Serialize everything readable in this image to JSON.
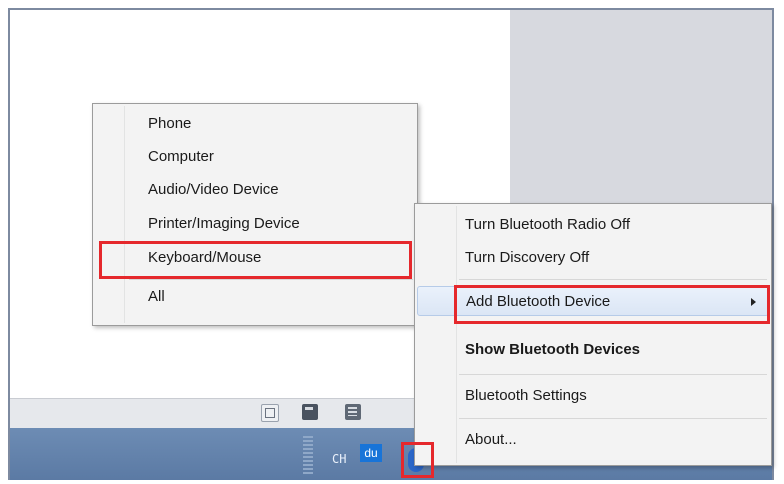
{
  "submenu": {
    "items": [
      {
        "label": "Phone"
      },
      {
        "label": "Computer"
      },
      {
        "label": "Audio/Video Device"
      },
      {
        "label": "Printer/Imaging Device"
      },
      {
        "label": "Keyboard/Mouse"
      },
      {
        "label": "All"
      }
    ]
  },
  "context_menu": {
    "items": [
      {
        "label": "Turn Bluetooth Radio Off"
      },
      {
        "label": "Turn Discovery Off"
      },
      {
        "label": "Add Bluetooth Device"
      },
      {
        "label": "Show Bluetooth Devices"
      },
      {
        "label": "Bluetooth Settings"
      },
      {
        "label": "About..."
      }
    ]
  },
  "taskbar": {
    "language_indicator": "CH",
    "ime_label": "du"
  },
  "icons": {
    "bluetooth": "bluetooth-icon",
    "submenu_arrow": "chevron-right-icon"
  },
  "colors": {
    "highlight_box": "#e5282c",
    "taskbar": "#6d8cb4"
  }
}
